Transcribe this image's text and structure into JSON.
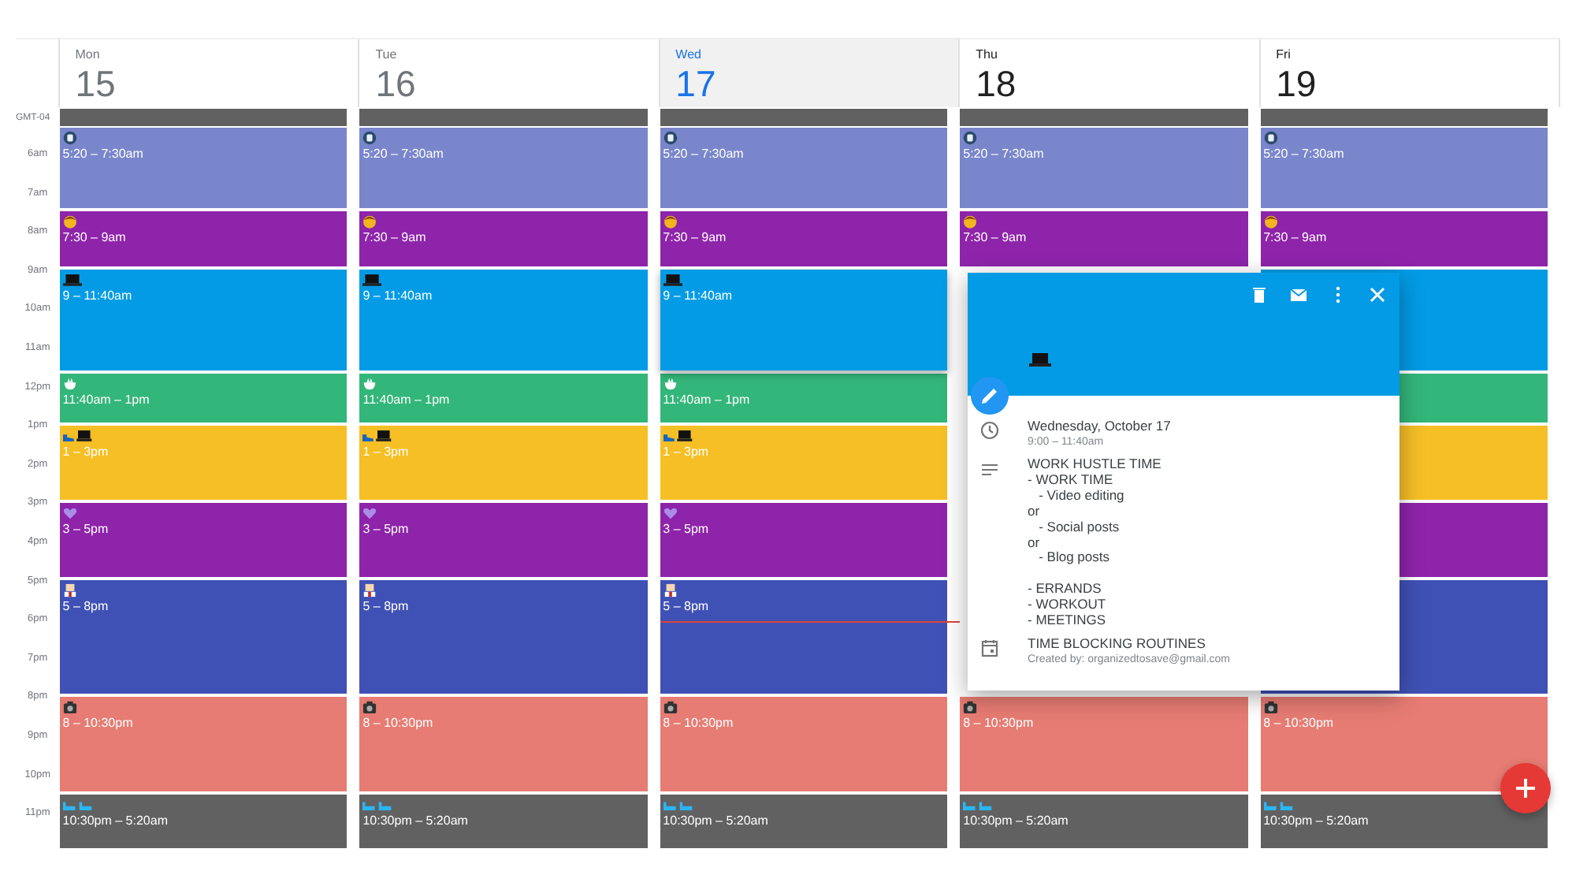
{
  "timezone": "GMT-04",
  "hours": [
    "6am",
    "7am",
    "8am",
    "9am",
    "10am",
    "11am",
    "12pm",
    "1pm",
    "2pm",
    "3pm",
    "4pm",
    "5pm",
    "6pm",
    "7pm",
    "8pm",
    "9pm",
    "10pm",
    "11pm"
  ],
  "days": [
    {
      "name": "Mon",
      "date": "15",
      "past": true,
      "today": false,
      "current_time": false,
      "events": [
        {
          "kind": "wake",
          "time": "5:20 – 7:30am"
        },
        {
          "kind": "morning",
          "time": "7:30 – 9am"
        },
        {
          "kind": "work",
          "time": "9 – 11:40am"
        },
        {
          "kind": "lunch",
          "time": "11:40am – 1pm"
        },
        {
          "kind": "afternoon",
          "time": "1 – 3pm"
        },
        {
          "kind": "selfcare",
          "time": "3 – 5pm"
        },
        {
          "kind": "family",
          "time": "5 – 8pm"
        },
        {
          "kind": "evening",
          "time": "8 – 10:30pm"
        },
        {
          "kind": "sleep",
          "time": "10:30pm – 5:20am"
        }
      ]
    },
    {
      "name": "Tue",
      "date": "16",
      "past": true,
      "today": false,
      "current_time": false,
      "events": [
        {
          "kind": "wake",
          "time": "5:20 – 7:30am"
        },
        {
          "kind": "morning",
          "time": "7:30 – 9am"
        },
        {
          "kind": "work",
          "time": "9 – 11:40am"
        },
        {
          "kind": "lunch",
          "time": "11:40am – 1pm"
        },
        {
          "kind": "afternoon",
          "time": "1 – 3pm"
        },
        {
          "kind": "selfcare",
          "time": "3 – 5pm"
        },
        {
          "kind": "family",
          "time": "5 – 8pm"
        },
        {
          "kind": "evening",
          "time": "8 – 10:30pm"
        },
        {
          "kind": "sleep",
          "time": "10:30pm – 5:20am"
        }
      ]
    },
    {
      "name": "Wed",
      "date": "17",
      "past": false,
      "today": true,
      "current_time": true,
      "events": [
        {
          "kind": "wake",
          "time": "5:20 – 7:30am"
        },
        {
          "kind": "morning",
          "time": "7:30 – 9am"
        },
        {
          "kind": "work",
          "time": "9 – 11:40am"
        },
        {
          "kind": "lunch",
          "time": "11:40am – 1pm"
        },
        {
          "kind": "afternoon",
          "time": "1 – 3pm"
        },
        {
          "kind": "selfcare",
          "time": "3 – 5pm"
        },
        {
          "kind": "family",
          "time": "5 – 8pm"
        },
        {
          "kind": "evening",
          "time": "8 – 10:30pm"
        },
        {
          "kind": "sleep",
          "time": "10:30pm – 5:20am"
        }
      ]
    },
    {
      "name": "Thu",
      "date": "18",
      "past": false,
      "today": false,
      "current_time": false,
      "events": [
        {
          "kind": "wake",
          "time": "5:20 – 7:30am"
        },
        {
          "kind": "morning",
          "time": "7:30 – 9am"
        },
        {
          "kind": "evening",
          "time": "8 – 10:30pm"
        },
        {
          "kind": "sleep",
          "time": "10:30pm – 5:20am"
        }
      ]
    },
    {
      "name": "Fri",
      "date": "19",
      "past": false,
      "today": false,
      "current_time": false,
      "events": [
        {
          "kind": "wake",
          "time": "5:20 – 7:30am"
        },
        {
          "kind": "morning",
          "time": "7:30 – 9am"
        },
        {
          "kind": "work"
        },
        {
          "kind": "lunch"
        },
        {
          "kind": "afternoon"
        },
        {
          "kind": "selfcare"
        },
        {
          "kind": "family"
        },
        {
          "kind": "evening",
          "time": "8 – 10:30pm"
        },
        {
          "kind": "sleep",
          "time": "10:30pm – 5:20am"
        }
      ]
    }
  ],
  "popup": {
    "date": "Wednesday, October 17",
    "time": "9:00 – 11:40am",
    "description": "WORK HUSTLE TIME\n- WORK TIME\n   - Video editing\nor\n   - Social posts\nor\n   - Blog posts\n\n- ERRANDS\n- WORKOUT\n- MEETINGS",
    "calendar": "TIME BLOCKING ROUTINES",
    "creator": "Created by: organizedtosave@gmail.com"
  }
}
